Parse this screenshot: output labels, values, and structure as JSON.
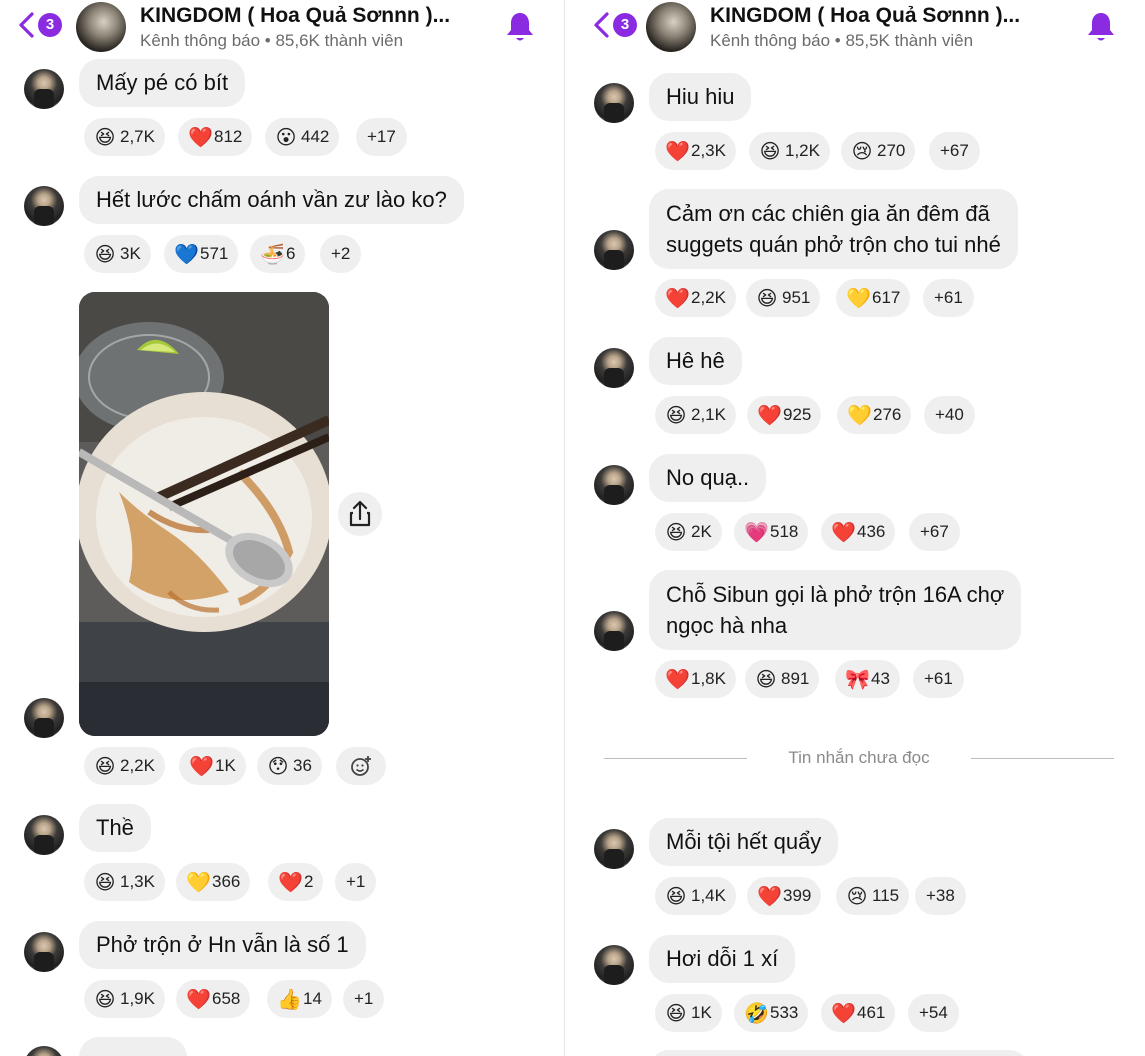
{
  "left": {
    "header": {
      "badge": "3",
      "title": "KINGDOM ( Hoa Quả Sơnnn )...",
      "subtitle": "Kênh thông báo • 85,6K thành viên"
    },
    "messages": [
      {
        "text": "Mấy pé có bít",
        "reactions": [
          [
            "laugh",
            "2,7K"
          ],
          [
            "heart",
            "812"
          ],
          [
            "wow",
            "442"
          ],
          [
            "more",
            "+17"
          ]
        ]
      },
      {
        "text": "Hết lước chấm oánh vần zư lào ko?",
        "reactions": [
          [
            "laugh",
            "3K"
          ],
          [
            "blue-heart",
            "571"
          ],
          [
            "noodle",
            "6"
          ],
          [
            "more",
            "+2"
          ]
        ]
      },
      {
        "text": "",
        "reactions": [
          [
            "laugh",
            "2,2K"
          ],
          [
            "heart",
            "1K"
          ],
          [
            "hush",
            "36"
          ],
          [
            "add",
            ""
          ]
        ]
      },
      {
        "text": "Thề",
        "reactions": [
          [
            "laugh",
            "1,3K"
          ],
          [
            "yellow-heart",
            "366"
          ],
          [
            "heart",
            "2"
          ],
          [
            "more",
            "+1"
          ]
        ]
      },
      {
        "text": "Phở trộn ở Hn vẫn là số 1",
        "reactions": [
          [
            "laugh",
            "1,9K"
          ],
          [
            "heart",
            "658"
          ],
          [
            "thumbs",
            "14"
          ],
          [
            "more",
            "+1"
          ]
        ]
      }
    ]
  },
  "right": {
    "header": {
      "badge": "3",
      "title": "KINGDOM ( Hoa Quả Sơnnn )...",
      "subtitle": "Kênh thông báo • 85,5K thành viên"
    },
    "messages": [
      {
        "text": "Hiu hiu",
        "reactions": [
          [
            "heart",
            "2,3K"
          ],
          [
            "laugh",
            "1,2K"
          ],
          [
            "cry",
            "270"
          ],
          [
            "more",
            "+67"
          ]
        ]
      },
      {
        "line1": "Cảm ơn các chiên gia ăn đêm đã",
        "line2": "suggets quán phở trộn cho tui nhé",
        "reactions": [
          [
            "heart",
            "2,2K"
          ],
          [
            "laugh",
            "951"
          ],
          [
            "yellow-heart",
            "617"
          ],
          [
            "more",
            "+61"
          ]
        ]
      },
      {
        "text": "Hê hê",
        "reactions": [
          [
            "laugh",
            "2,1K"
          ],
          [
            "heart",
            "925"
          ],
          [
            "yellow-heart",
            "276"
          ],
          [
            "more",
            "+40"
          ]
        ]
      },
      {
        "text": "No quạ..",
        "reactions": [
          [
            "laugh",
            "2K"
          ],
          [
            "pink-heart",
            "518"
          ],
          [
            "heart",
            "436"
          ],
          [
            "more",
            "+67"
          ]
        ]
      },
      {
        "line1": "Chỗ Sibun gọi là phở trộn 16A chợ",
        "line2": "ngọc hà nha",
        "reactions": [
          [
            "heart",
            "1,8K"
          ],
          [
            "laugh",
            "891"
          ],
          [
            "ribbon",
            "43"
          ],
          [
            "more",
            "+61"
          ]
        ]
      },
      {
        "text": "Mỗi tội hết quẩy",
        "reactions": [
          [
            "laugh",
            "1,4K"
          ],
          [
            "heart",
            "399"
          ],
          [
            "cry",
            "115"
          ],
          [
            "more",
            "+38"
          ]
        ]
      },
      {
        "text": "Hơi dỗi 1 xí",
        "reactions": [
          [
            "laugh",
            "1K"
          ],
          [
            "rofl",
            "533"
          ],
          [
            "heart",
            "461"
          ],
          [
            "more",
            "+54"
          ]
        ]
      }
    ],
    "divider": "Tin nhắn chưa đọc"
  },
  "colors": {
    "accent": "#8a2be2",
    "bubble": "#efefef",
    "heart": "#e0245e"
  }
}
